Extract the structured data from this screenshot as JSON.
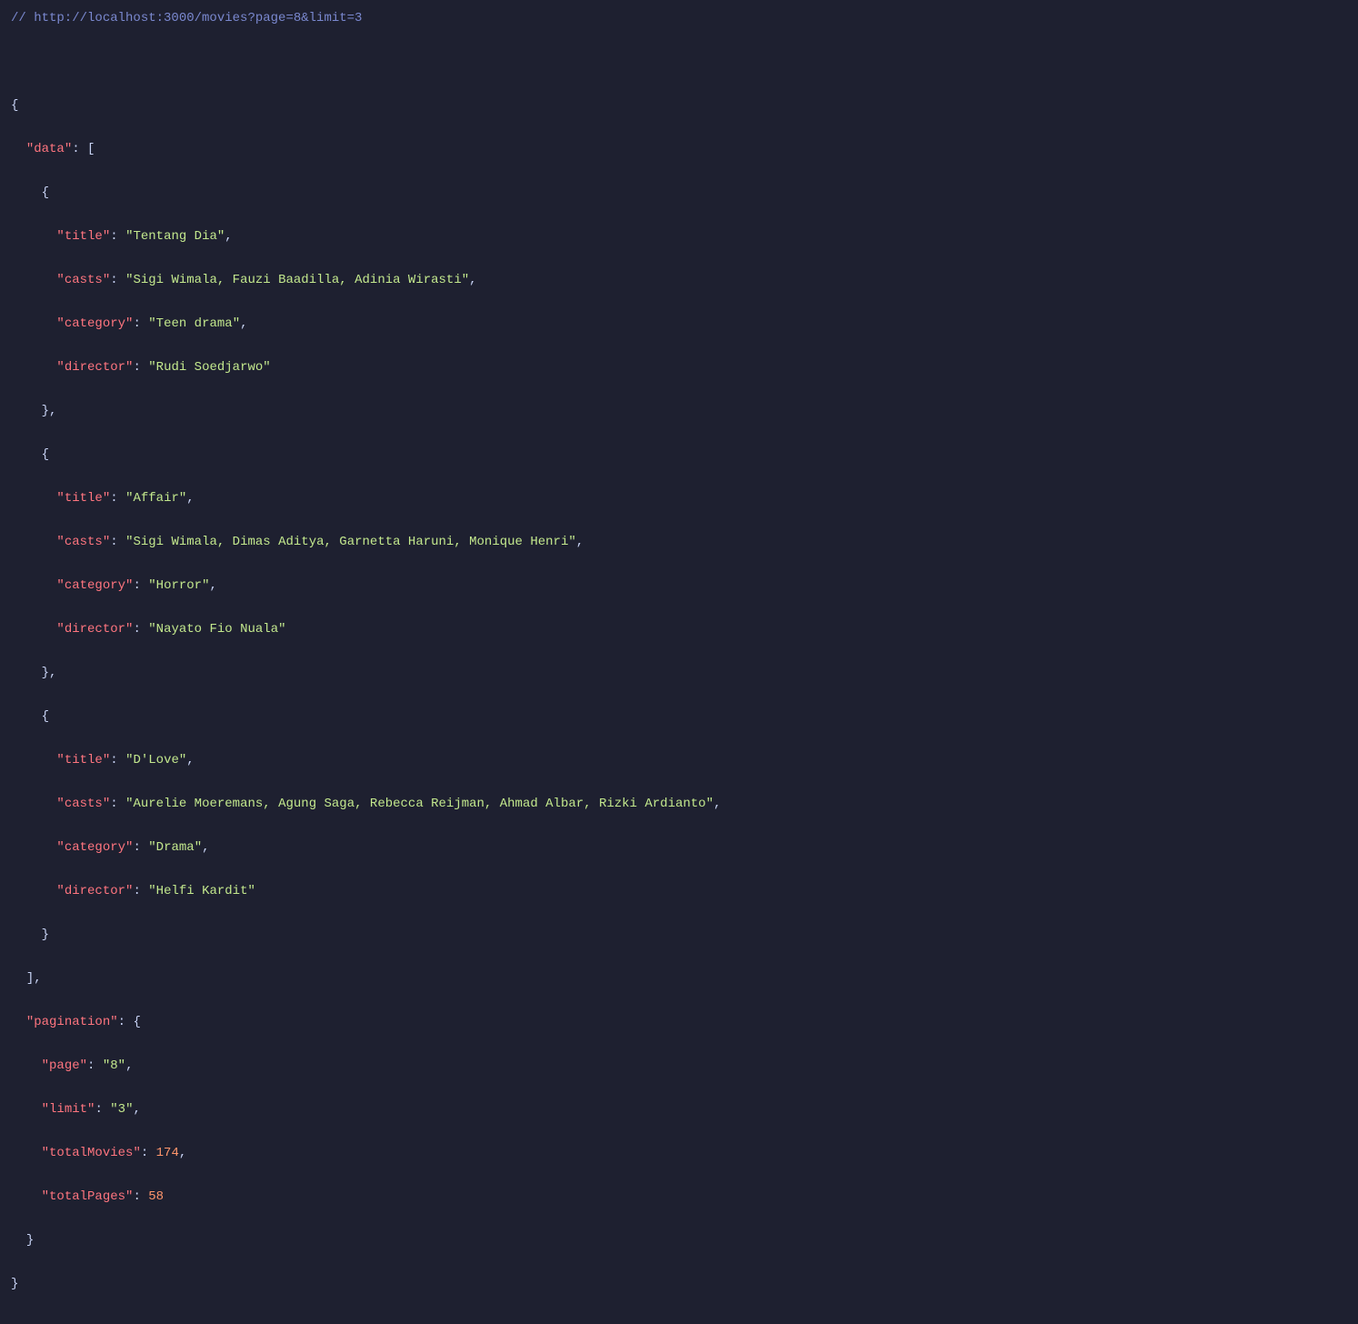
{
  "comment": "// http://localhost:3000/movies?page=8&limit=3",
  "json": {
    "data": [
      {
        "title": "Tentang Dia",
        "casts": "Sigi Wimala, Fauzi Baadilla, Adinia Wirasti",
        "category": "Teen drama",
        "director": "Rudi Soedjarwo"
      },
      {
        "title": "Affair",
        "casts": "Sigi Wimala, Dimas Aditya, Garnetta Haruni, Monique Henri",
        "category": "Horror",
        "director": "Nayato Fio Nuala"
      },
      {
        "title": "D'Love",
        "casts": "Aurelie Moeremans, Agung Saga, Rebecca Reijman, Ahmad Albar, Rizki Ardianto",
        "category": "Drama",
        "director": "Helfi Kardit"
      }
    ],
    "pagination": {
      "page": "8",
      "limit": "3",
      "totalMovies": 174,
      "totalPages": 58
    }
  },
  "keys": {
    "data": "data",
    "title": "title",
    "casts": "casts",
    "category": "category",
    "director": "director",
    "pagination": "pagination",
    "page": "page",
    "limit": "limit",
    "totalMovies": "totalMovies",
    "totalPages": "totalPages"
  }
}
